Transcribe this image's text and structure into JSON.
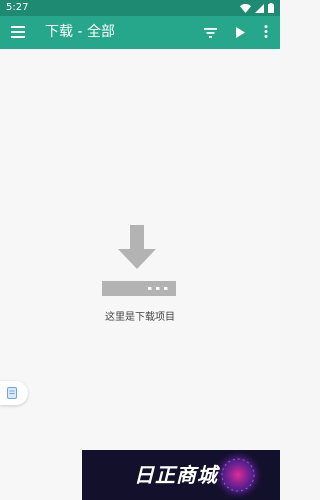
{
  "status_bar": {
    "time": "5:27",
    "icons": [
      "wifi-icon",
      "signal-icon",
      "battery-icon"
    ]
  },
  "app_bar": {
    "title": "下载 - 全部",
    "background": "#26a68a",
    "status_background": "#1e8a72",
    "actions": [
      "menu-icon",
      "filter-icon",
      "play-icon",
      "more-vertical-icon"
    ]
  },
  "empty_state": {
    "icon": "download-icon",
    "message": "这里是下载项目",
    "icon_color": "#b3b3b3"
  },
  "side_tab": {
    "icon": "document-icon"
  },
  "ad_banner": {
    "logo_text": "日正商城",
    "background": "#12102a",
    "accent": "#ff2fa0"
  }
}
